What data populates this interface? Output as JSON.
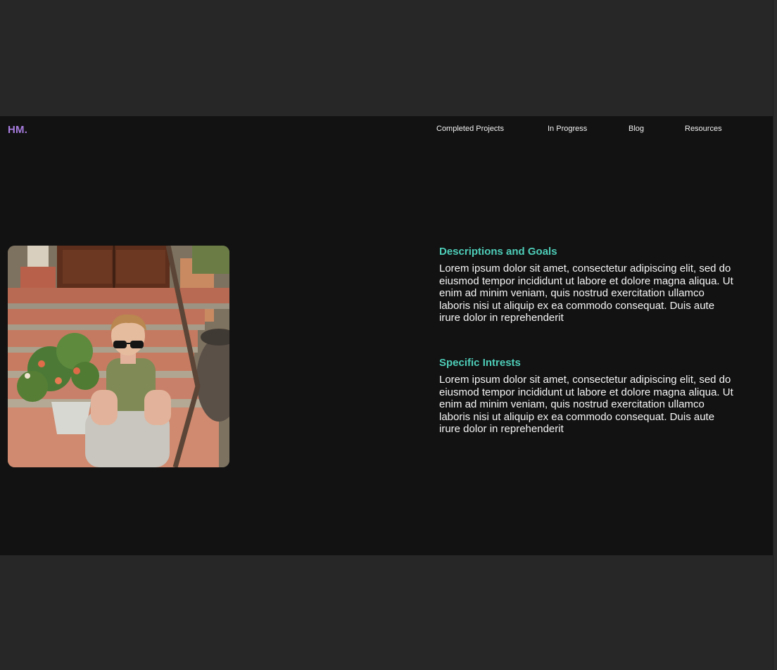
{
  "nav": {
    "logo": "HM.",
    "links": [
      {
        "label": "Completed Projects"
      },
      {
        "label": "In Progress"
      },
      {
        "label": "Blog"
      },
      {
        "label": "Resources"
      }
    ]
  },
  "sections": [
    {
      "title": "Descriptions and Goals",
      "body": "Lorem ipsum dolor sit amet, consectetur adipiscing elit, sed do eiusmod tempor incididunt ut labore et dolore magna aliqua. Ut enim ad minim veniam, quis nostrud exercitation ullamco laboris nisi ut aliquip ex ea commodo consequat. Duis aute irure dolor in reprehenderit"
    },
    {
      "title": "Specific Intrests",
      "body": "Lorem ipsum dolor sit amet, consectetur adipiscing elit, sed do eiusmod tempor incididunt ut labore et dolore magna aliqua. Ut enim ad minim veniam, quis nostrud exercitation ullamco laboris nisi ut aliquip ex ea commodo consequat. Duis aute irure dolor in reprehenderit"
    }
  ],
  "colors": {
    "outer_background": "#272727",
    "page_background": "#121212",
    "logo": "#a87de0",
    "section_title": "#4ecdb8",
    "text": "#f5f5f5"
  },
  "photo": {
    "icon": "portrait-photo"
  }
}
